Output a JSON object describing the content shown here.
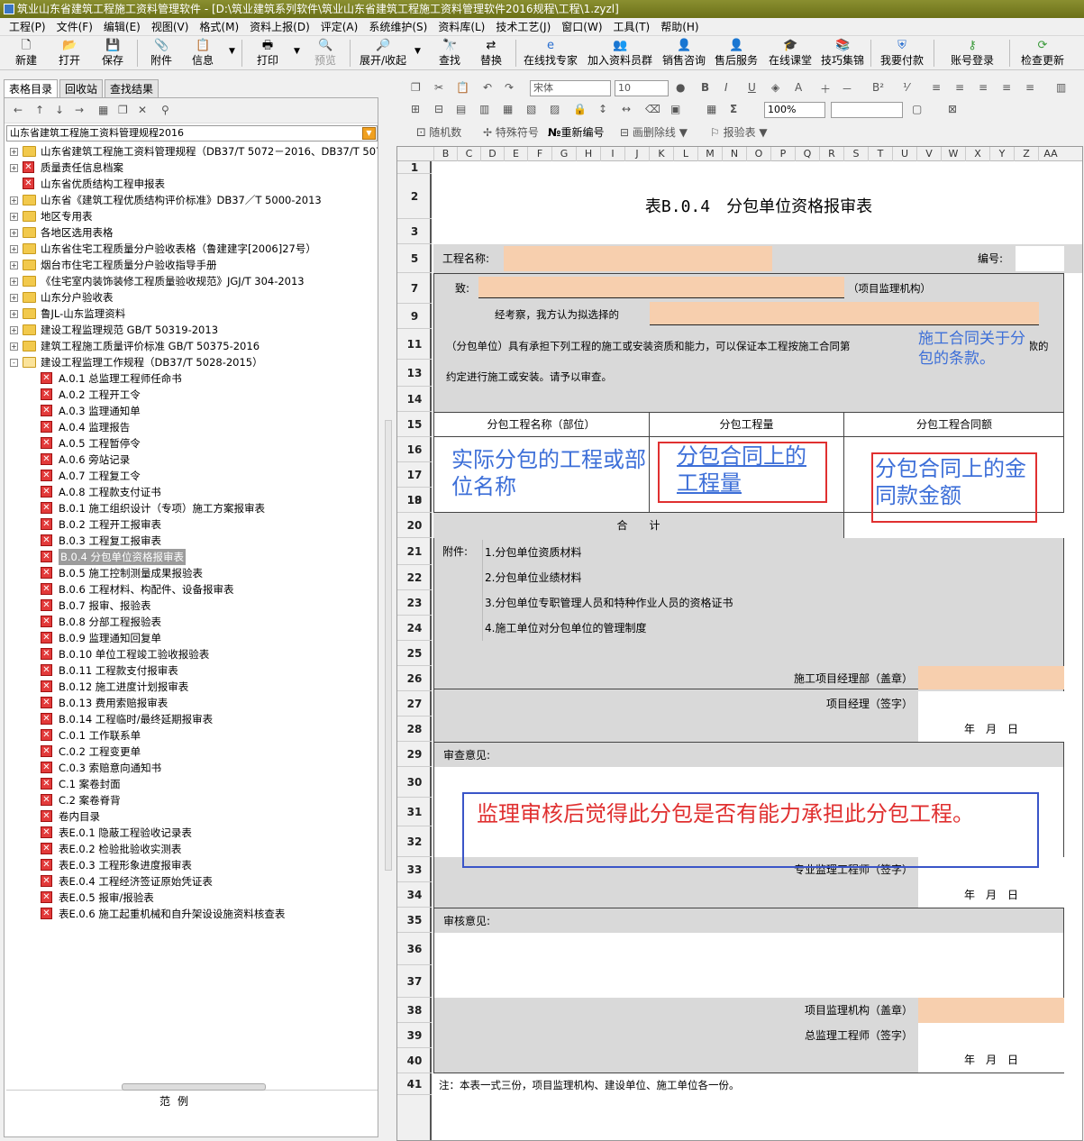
{
  "window": {
    "title": "筑业山东省建筑工程施工资料管理软件 - [D:\\筑业建筑系列软件\\筑业山东省建筑工程施工资料管理软件2016规程\\工程\\1.zyzl]"
  },
  "menu": [
    "工程(P)",
    "文件(F)",
    "编辑(E)",
    "视图(V)",
    "格式(M)",
    "资料上报(D)",
    "评定(A)",
    "系统维护(S)",
    "资料库(L)",
    "技术工艺(J)",
    "窗口(W)",
    "工具(T)",
    "帮助(H)"
  ],
  "toolbar": {
    "new": "新建",
    "open": "打开",
    "save": "保存",
    "attach": "附件",
    "info": "信息",
    "print": "打印",
    "preview": "预览",
    "expand": "展开/收起",
    "find": "查找",
    "replace": "替换",
    "expert": "在线找专家",
    "group": "加入资料员群",
    "sales": "销售咨询",
    "after": "售后服务",
    "class": "在线课堂",
    "tips": "技巧集锦",
    "pay": "我要付款",
    "login": "账号登录",
    "update": "检查更新"
  },
  "left": {
    "tabs": [
      "表格目录",
      "回收站",
      "查找结果"
    ],
    "combo": "山东省建筑工程施工资料管理规程2016",
    "tree": [
      {
        "t": "山东省建筑工程施工资料管理规程（DB37/T 5072－2016、DB37/T 507",
        "k": "f",
        "exp": "+"
      },
      {
        "t": "质量责任信息档案",
        "k": "d",
        "exp": "+"
      },
      {
        "t": "山东省优质结构工程申报表",
        "k": "d",
        "exp": ""
      },
      {
        "t": "山东省《建筑工程优质结构评价标准》DB37／T 5000-2013",
        "k": "f",
        "exp": "+"
      },
      {
        "t": "地区专用表",
        "k": "f",
        "exp": "+"
      },
      {
        "t": "各地区选用表格",
        "k": "f",
        "exp": "+"
      },
      {
        "t": "山东省住宅工程质量分户验收表格（鲁建建字[2006]27号）",
        "k": "f",
        "exp": "+"
      },
      {
        "t": "烟台市住宅工程质量分户验收指导手册",
        "k": "f",
        "exp": "+"
      },
      {
        "t": "《住宅室内装饰装修工程质量验收规范》JGJ/T 304-2013",
        "k": "f",
        "exp": "+"
      },
      {
        "t": "山东分户验收表",
        "k": "f",
        "exp": "+"
      },
      {
        "t": "鲁JL-山东监理资料",
        "k": "f",
        "exp": "+"
      },
      {
        "t": "建设工程监理规范 GB/T 50319-2013",
        "k": "f",
        "exp": "+"
      },
      {
        "t": "建筑工程施工质量评价标准 GB/T 50375-2016",
        "k": "f",
        "exp": "+"
      },
      {
        "t": "建设工程监理工作规程（DB37/T 5028-2015）",
        "k": "o",
        "exp": "-"
      },
      {
        "t": "A.0.1 总监理工程师任命书",
        "k": "c"
      },
      {
        "t": "A.0.2 工程开工令",
        "k": "c"
      },
      {
        "t": "A.0.3 监理通知单",
        "k": "c"
      },
      {
        "t": "A.0.4 监理报告",
        "k": "c"
      },
      {
        "t": "A.0.5 工程暂停令",
        "k": "c"
      },
      {
        "t": "A.0.6 旁站记录",
        "k": "c"
      },
      {
        "t": "A.0.7 工程复工令",
        "k": "c"
      },
      {
        "t": "A.0.8 工程款支付证书",
        "k": "c"
      },
      {
        "t": "B.0.1 施工组织设计（专项）施工方案报审表",
        "k": "c"
      },
      {
        "t": "B.0.2 工程开工报审表",
        "k": "c"
      },
      {
        "t": "B.0.3 工程复工报审表",
        "k": "c"
      },
      {
        "t": "B.0.4 分包单位资格报审表",
        "k": "c",
        "sel": true
      },
      {
        "t": "B.0.5 施工控制测量成果报验表",
        "k": "c"
      },
      {
        "t": "B.0.6 工程材料、构配件、设备报审表",
        "k": "c"
      },
      {
        "t": "B.0.7 报审、报验表",
        "k": "c"
      },
      {
        "t": "B.0.8 分部工程报验表",
        "k": "c"
      },
      {
        "t": "B.0.9 监理通知回复单",
        "k": "c"
      },
      {
        "t": "B.0.10 单位工程竣工验收报验表",
        "k": "c"
      },
      {
        "t": "B.0.11 工程款支付报审表",
        "k": "c"
      },
      {
        "t": "B.0.12 施工进度计划报审表",
        "k": "c"
      },
      {
        "t": "B.0.13 费用索赔报审表",
        "k": "c"
      },
      {
        "t": "B.0.14 工程临时/最终延期报审表",
        "k": "c"
      },
      {
        "t": "C.0.1 工作联系单",
        "k": "c"
      },
      {
        "t": "C.0.2 工程变更单",
        "k": "c"
      },
      {
        "t": "C.0.3 索赔意向通知书",
        "k": "c"
      },
      {
        "t": "C.1 案卷封面",
        "k": "c"
      },
      {
        "t": "C.2 案卷脊背",
        "k": "c"
      },
      {
        "t": "卷内目录",
        "k": "c"
      },
      {
        "t": "表E.0.1 隐蔽工程验收记录表",
        "k": "c"
      },
      {
        "t": "表E.0.2 检验批验收实测表",
        "k": "c"
      },
      {
        "t": "表E.0.3 工程形象进度报审表",
        "k": "c"
      },
      {
        "t": "表E.0.4 工程经济签证原始凭证表",
        "k": "c"
      },
      {
        "t": "表E.0.5 报审/报验表",
        "k": "c"
      },
      {
        "t": "表E.0.6 施工起重机械和自升架设设施资料核查表",
        "k": "c"
      }
    ],
    "legend": "范例"
  },
  "format": {
    "font": "宋体",
    "size": "10",
    "zoom": "100%",
    "random": "随机数",
    "special": "特殊符号",
    "renumber": "重新编号",
    "strike": "画删除线",
    "verify": "报验表"
  },
  "columns": [
    "B",
    "C",
    "D",
    "E",
    "F",
    "G",
    "H",
    "I",
    "J",
    "K",
    "L",
    "M",
    "N",
    "O",
    "P",
    "Q",
    "R",
    "S",
    "T",
    "U",
    "V",
    "W",
    "X",
    "Y",
    "Z",
    "AA"
  ],
  "rows": [
    "1",
    "2",
    "3",
    "5",
    "7",
    "9",
    "11",
    "13",
    "14",
    "15",
    "16",
    "17",
    "18",
    "19",
    "20",
    "21",
    "22",
    "23",
    "24",
    "25",
    "26",
    "27",
    "28",
    "29",
    "30",
    "31",
    "32",
    "33",
    "34",
    "35",
    "36",
    "37",
    "38",
    "39",
    "40",
    "41"
  ],
  "form": {
    "title": "表B.0.4　分包单位资格报审表",
    "project_name": "工程名称:",
    "number": "编号:",
    "to": "致:",
    "to_unit": "（项目监理机构）",
    "after_review": "经考察，我方认为拟选择的",
    "para1": "（分包单位）具有承担下列工程的施工或安装资质和能力，可以保证本工程按施工合同第",
    "para1_end": "条款的",
    "para2": "约定进行施工或安装。请予以审查。",
    "col1": "分包工程名称（部位）",
    "col2": "分包工程量",
    "col3": "分包工程合同额",
    "total": "合　　计",
    "attach_label": "附件:",
    "attachments": [
      "1.分包单位资质材料",
      "2.分包单位业绩材料",
      "3.分包单位专职管理人员和特种作业人员的资格证书",
      "4.施工单位对分包单位的管理制度"
    ],
    "sig1": "施工项目经理部（盖章）",
    "sig2": "项目经理（签字）",
    "date": "年　月　日",
    "review": "审查意见:",
    "sig3": "专业监理工程师（签字）",
    "audit": "审核意见:",
    "sig4": "项目监理机构（盖章）",
    "sig5": "总监理工程师（签字）",
    "note": "注：本表一式三份，项目监理机构、建设单位、施工单位各一份。"
  },
  "annotations": {
    "contract": "施工合同关于分包的条款。",
    "name": "实际分包的工程或部位名称",
    "qty": "分包合同上的工程量",
    "amount": "分包合同上的金同款金额",
    "review": "监理审核后觉得此分包是否有能力承担此分包工程。"
  }
}
